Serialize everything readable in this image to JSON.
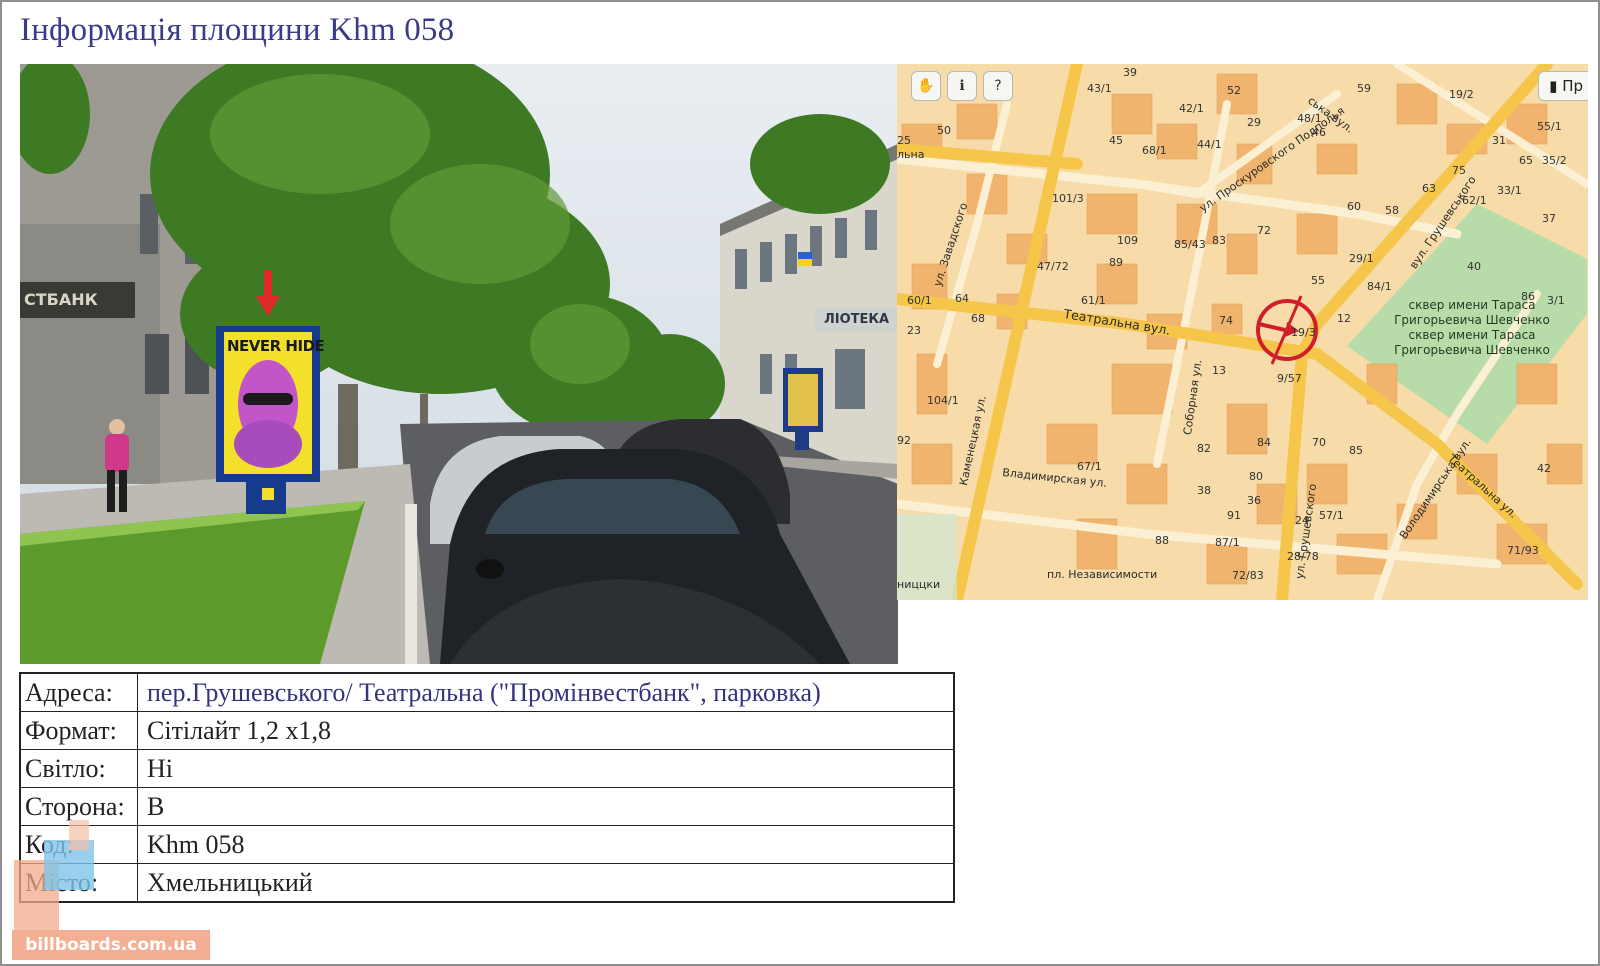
{
  "title": "Інформація площини Khm 058",
  "photo": {
    "bank_sign": "СТБАНК",
    "building_sign": "ЛІОТЕКА",
    "ad_title": "NEVER HIDE"
  },
  "map": {
    "toolbar": [
      "hand-tool",
      "info-tool",
      "help-tool"
    ],
    "print_label": "Пр",
    "streets": [
      "Театральна вул.",
      "ул. Проскуровского Подполья",
      "ул. Завадского",
      "Каменецкая ул.",
      "Соборная ул.",
      "ул. Грушевского",
      "Владимирская ул.",
      "Володимирська вул.",
      "Театральна ул.",
      "вул. Грушевського",
      "пл. Независимости",
      "ська вул.",
      "ниццки",
      "льна"
    ],
    "park": {
      "name_line1": "сквер имени Тараса",
      "name_line2": "Григорьевича Шевченко"
    },
    "numbers": [
      "39",
      "43/1",
      "42/1",
      "52",
      "45",
      "68/1",
      "44/1",
      "29",
      "48/1",
      "46",
      "59",
      "19/2",
      "31",
      "55/1",
      "35/2",
      "65",
      "33/1",
      "37",
      "62/1",
      "75",
      "40",
      "63",
      "58",
      "60",
      "55",
      "61/1",
      "47/72",
      "109",
      "101/3",
      "89",
      "85/43",
      "83",
      "72",
      "29/1",
      "23",
      "60/1",
      "64",
      "68",
      "104/1",
      "92",
      "67/1",
      "82",
      "84",
      "80",
      "36",
      "38",
      "70",
      "85",
      "57/1",
      "71/93",
      "91",
      "88",
      "87/1",
      "72/83",
      "28/78",
      "24",
      "9/57",
      "13",
      "74",
      "19/3",
      "12",
      "42",
      "3/1",
      "86",
      "84/1",
      "25",
      "50"
    ]
  },
  "info": {
    "rows": [
      {
        "label": "Адреса:",
        "value": "пер.Грушевського/ Театральна (\"Промінвестбанк\", парковка)"
      },
      {
        "label": "Формат:",
        "value": "Сітілайт 1,2 х1,8"
      },
      {
        "label": "Світло:",
        "value": "Hi"
      },
      {
        "label": "Сторона:",
        "value": "B"
      },
      {
        "label": "Код:",
        "value": "Khm 058"
      },
      {
        "label": "Місто:",
        "value": "Хмельницький"
      }
    ]
  },
  "logo": {
    "text": "billboards.com.ua"
  },
  "colors": {
    "title": "#3b3b8a",
    "map_base": "#f7dcaa",
    "map_building": "#f0b46e",
    "map_road": "#f6c64a",
    "park": "#b7dba9",
    "marker": "#d01f2a"
  }
}
